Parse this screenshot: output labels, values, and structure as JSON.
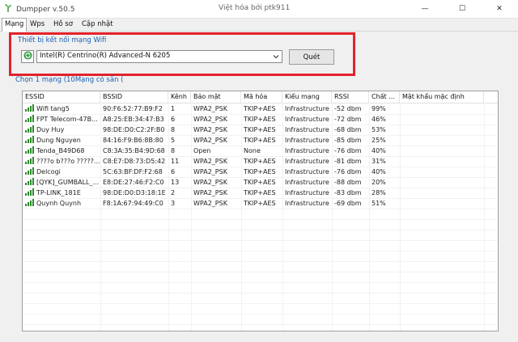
{
  "window": {
    "title": "Dumpper v.50.5",
    "center_title": "Việt hóa bởi ptk911",
    "minimize": "—",
    "maximize": "☐",
    "close": "✕"
  },
  "tabs": [
    {
      "label": "Mạng",
      "active": true
    },
    {
      "label": "Wps",
      "active": false
    },
    {
      "label": "Hồ sơ",
      "active": false
    },
    {
      "label": "Cập nhật",
      "active": false
    }
  ],
  "adapter": {
    "group_label": "Thiết bị kết nối mạng Wifi",
    "selected": "Intel(R) Centrino(R) Advanced-N 6205",
    "scan_label": "Quét"
  },
  "network_list": {
    "caption": "Chọn 1 mạng (10Mạng có sẵn (",
    "columns": [
      "ESSID",
      "BSSID",
      "Kênh",
      "Bảo mật",
      "Mã hóa",
      "Kiểu mạng",
      "RSSI",
      "Chất ...",
      "Mật khẩu mặc định"
    ],
    "rows": [
      {
        "essid": "Wifi tang5",
        "bssid": "90:F6:52:77:B9:F2",
        "channel": "1",
        "security": "WPA2_PSK",
        "cipher": "TKIP+AES",
        "mode": "Infrastructure",
        "rssi": "-52 dbm",
        "quality": "99%",
        "default_pass": ""
      },
      {
        "essid": "FPT Telecom-47B...",
        "bssid": "A8:25:EB:34:47:B3",
        "channel": "6",
        "security": "WPA2_PSK",
        "cipher": "TKIP+AES",
        "mode": "Infrastructure",
        "rssi": "-72 dbm",
        "quality": "46%",
        "default_pass": ""
      },
      {
        "essid": "Duy Huy",
        "bssid": "98:DE:D0:C2:2F:B0",
        "channel": "8",
        "security": "WPA2_PSK",
        "cipher": "TKIP+AES",
        "mode": "Infrastructure",
        "rssi": "-68 dbm",
        "quality": "53%",
        "default_pass": ""
      },
      {
        "essid": "Dung Nguyen",
        "bssid": "84:16:F9:B6:8B:80",
        "channel": "5",
        "security": "WPA2_PSK",
        "cipher": "TKIP+AES",
        "mode": "Infrastructure",
        "rssi": "-85 dbm",
        "quality": "25%",
        "default_pass": ""
      },
      {
        "essid": "Tenda_B49D68",
        "bssid": "C8:3A:35:B4:9D:68",
        "channel": "8",
        "security": "Open",
        "cipher": "None",
        "mode": "Infrastructure",
        "rssi": "-76 dbm",
        "quality": "40%",
        "default_pass": ""
      },
      {
        "essid": "????o b???o ?????...",
        "bssid": "C8:E7:D8:73:D5:42",
        "channel": "11",
        "security": "WPA2_PSK",
        "cipher": "TKIP+AES",
        "mode": "Infrastructure",
        "rssi": "-81 dbm",
        "quality": "31%",
        "default_pass": ""
      },
      {
        "essid": "Delcogi",
        "bssid": "5C:63:BF:DF:F2:68",
        "channel": "6",
        "security": "WPA2_PSK",
        "cipher": "TKIP+AES",
        "mode": "Infrastructure",
        "rssi": "-76 dbm",
        "quality": "40%",
        "default_pass": ""
      },
      {
        "essid": "[QYK]_GUMBALL_...",
        "bssid": "E8:DE:27:46:F2:C0",
        "channel": "13",
        "security": "WPA2_PSK",
        "cipher": "TKIP+AES",
        "mode": "Infrastructure",
        "rssi": "-88 dbm",
        "quality": "20%",
        "default_pass": ""
      },
      {
        "essid": "TP-LINK_181E",
        "bssid": "98:DE:D0:D3:18:1E",
        "channel": "2",
        "security": "WPA2_PSK",
        "cipher": "TKIP+AES",
        "mode": "Infrastructure",
        "rssi": "-83 dbm",
        "quality": "28%",
        "default_pass": ""
      },
      {
        "essid": "Quynh Quynh",
        "bssid": "F8:1A:67:94:49:C0",
        "channel": "3",
        "security": "WPA2_PSK",
        "cipher": "TKIP+AES",
        "mode": "Infrastructure",
        "rssi": "-69 dbm",
        "quality": "51%",
        "default_pass": ""
      }
    ]
  },
  "colors": {
    "highlight_box": "#e3222b",
    "group_label": "#1a5fb4",
    "signal": "#2e8b2e"
  },
  "icons": {
    "app": "dumpper-app-icon",
    "refresh": "refresh-icon",
    "dropdown": "chevron-down-icon",
    "signal": "signal-bars-icon"
  }
}
